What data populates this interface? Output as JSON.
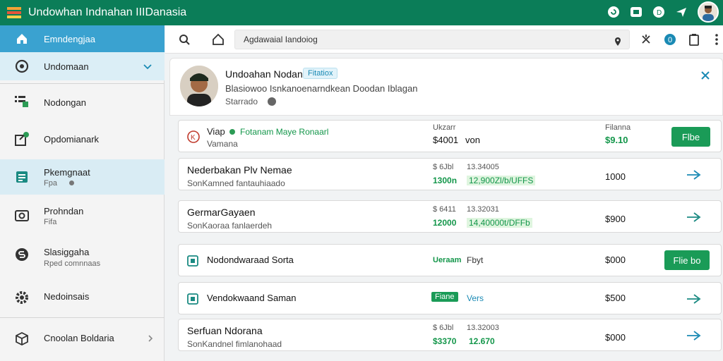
{
  "app": {
    "title": "Undowhan Indnahan IIIDanasia",
    "accent": "#0b7d58"
  },
  "sidebar": {
    "items": [
      {
        "label": "Emndengjaa",
        "icon": "home-icon"
      },
      {
        "label": "Undomaan",
        "icon": "refresh-icon"
      },
      {
        "label": "Nodongan",
        "icon": "list-icon"
      },
      {
        "label": "Opdomianark",
        "icon": "export-icon"
      },
      {
        "label": "Pkemgnaat",
        "sub": "Fpa",
        "icon": "document-icon"
      },
      {
        "label": "Prohndan",
        "sub": "Fifa",
        "icon": "camera-icon"
      },
      {
        "label": "Slasiggaha",
        "sub": "Rped comnnaas",
        "icon": "dollar-icon"
      },
      {
        "label": "Nedoinsais",
        "icon": "gear-icon"
      },
      {
        "label": "Cnoolan Boldaria",
        "icon": "box-icon"
      }
    ]
  },
  "toolbar": {
    "address": "Agdawaial Iandoiog"
  },
  "profile": {
    "name": "Undoahan Nodan",
    "chip": "Fitatiox",
    "description": "Blasiowoo Isnkanoenarndkean Doodan Iblagan",
    "status": "Starrado"
  },
  "rows": [
    {
      "kind": "header",
      "title": "Viap",
      "title_green": "Fotanam Maye Ronaarl",
      "sub": "Vamana",
      "h1": "Ukzarr",
      "v1": "$4001",
      "v1b": "von",
      "h3": "Filanna",
      "amt": "$9.10",
      "button": "Flbe"
    },
    {
      "kind": "data",
      "title": "Nederbakan Plv Nemae",
      "sub": "SonKamned fantauhiaado",
      "h1": "$ 6Jbl",
      "h2": "13.34005",
      "v1": "1300n",
      "v2": "12,900Zl/b/UFFS",
      "amt": "1000"
    },
    {
      "kind": "data",
      "title": "GermarGayaen",
      "sub": "SonKaoraa fanlaerdeh",
      "h1": "$ 6411",
      "h2": "13.32031",
      "v1": "12000",
      "v2": "14,40000t/DFFb",
      "amt": "$900"
    },
    {
      "kind": "action",
      "title": "Nodondwaraad Sorta",
      "green": "Ueraam",
      "text": "Fbyt",
      "amt": "$000",
      "button": "Flie bo"
    },
    {
      "kind": "action2",
      "title": "Vendokwaand Saman",
      "chip": "Fiane",
      "link": "Vers",
      "amt": "$500"
    },
    {
      "kind": "data",
      "title": "Serfuan Ndorana",
      "sub": "SonKandnel fimlanohaad",
      "h1": "$ 6Jbl",
      "h2": "13.32003",
      "v1": "$3370",
      "v2": "12.670",
      "amt": "$000"
    }
  ]
}
